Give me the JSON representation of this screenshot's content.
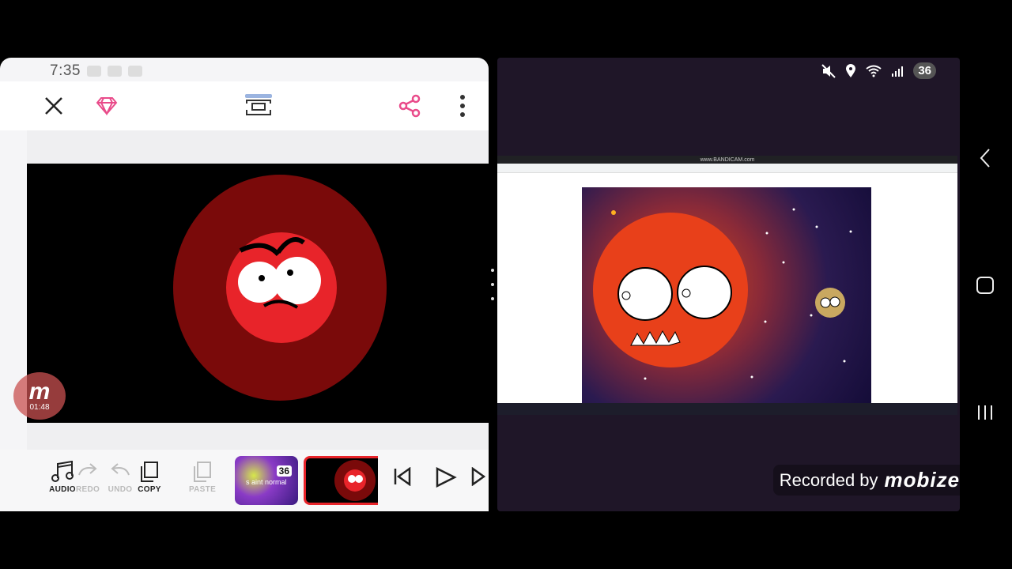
{
  "left": {
    "status": {
      "time": "7:35"
    },
    "toolbar": {
      "audio": "AUDIO",
      "redo": "REDO",
      "undo": "UNDO",
      "copy": "COPY",
      "paste": "PASTE"
    },
    "thumb1": {
      "badge": "36",
      "caption": "s aint normal"
    },
    "badge": {
      "logo": "m",
      "timer": "01:48"
    }
  },
  "right": {
    "status": {
      "battery": "36"
    },
    "browser": {
      "title": "www.BANDICAM.com"
    },
    "watermark": {
      "prefix": "Recorded by",
      "brand": "mobizen"
    }
  },
  "colors": {
    "accent_pink": "#e94b8a",
    "red": "#e8242a"
  }
}
